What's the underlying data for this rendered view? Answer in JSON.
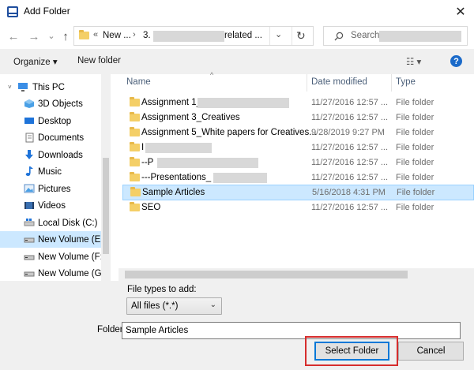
{
  "window": {
    "title": "Add Folder",
    "close_glyph": "✕"
  },
  "nav": {
    "back_glyph": "←",
    "forward_glyph": "→",
    "recent_glyph": "⌄",
    "up_glyph": "↑",
    "breadcrumb_prefix": "«",
    "breadcrumb_1": "New ...",
    "breadcrumb_sep": "›",
    "breadcrumb_2a": "3.",
    "breadcrumb_2b": "related ...",
    "dropdown_glyph": "⌄",
    "refresh_glyph": "↻",
    "search_placeholder": "Search"
  },
  "toolbar": {
    "organize_label": "Organize ▾",
    "new_folder_label": "New folder",
    "view_glyph": "☷ ▾",
    "help_glyph": "?"
  },
  "sidebar": {
    "items": [
      {
        "label": "This PC",
        "icon": "computer-icon"
      },
      {
        "label": "3D Objects",
        "icon": "3d-objects-icon"
      },
      {
        "label": "Desktop",
        "icon": "desktop-icon"
      },
      {
        "label": "Documents",
        "icon": "documents-icon"
      },
      {
        "label": "Downloads",
        "icon": "downloads-icon"
      },
      {
        "label": "Music",
        "icon": "music-icon"
      },
      {
        "label": "Pictures",
        "icon": "pictures-icon"
      },
      {
        "label": "Videos",
        "icon": "videos-icon"
      },
      {
        "label": "Local Disk (C:)",
        "icon": "disk-icon"
      },
      {
        "label": "New Volume (E:)",
        "icon": "drive-icon"
      },
      {
        "label": "New Volume (F:)",
        "icon": "drive-icon"
      },
      {
        "label": "New Volume (G:)",
        "icon": "drive-icon"
      }
    ]
  },
  "columns": {
    "name": "Name",
    "date": "Date modified",
    "type": "Type",
    "sort_glyph": "^"
  },
  "files": [
    {
      "name": "Assignment 1_",
      "date": "11/27/2016 12:57 ...",
      "type": "File folder"
    },
    {
      "name": "Assignment 3_Creatives",
      "date": "11/27/2016 12:57 ...",
      "type": "File folder"
    },
    {
      "name": "Assignment 5_White papers for Creatives...",
      "date": "9/28/2019 9:27 PM",
      "type": "File folder"
    },
    {
      "name": "I",
      "date": "11/27/2016 12:57 ...",
      "type": "File folder"
    },
    {
      "name": "--P",
      "date": "11/27/2016 12:57 ...",
      "type": "File folder"
    },
    {
      "name": "---Presentations_",
      "date": "11/27/2016 12:57 ...",
      "type": "File folder"
    },
    {
      "name": "Sample Articles",
      "date": "5/16/2018 4:31 PM",
      "type": "File folder"
    },
    {
      "name": "SEO",
      "date": "11/27/2016 12:57 ...",
      "type": "File folder"
    }
  ],
  "file_types": {
    "label": "File types to add:",
    "selected": "All files (*.*)",
    "arrow_glyph": "⌄"
  },
  "folder_field": {
    "label": "Folder:",
    "value": "Sample Articles"
  },
  "buttons": {
    "select_folder": "Select Folder",
    "cancel": "Cancel"
  },
  "colors": {
    "selection": "#cce8ff",
    "accent": "#0078d7",
    "highlight_box": "#d62d2d",
    "folder": "#f4cf67"
  }
}
